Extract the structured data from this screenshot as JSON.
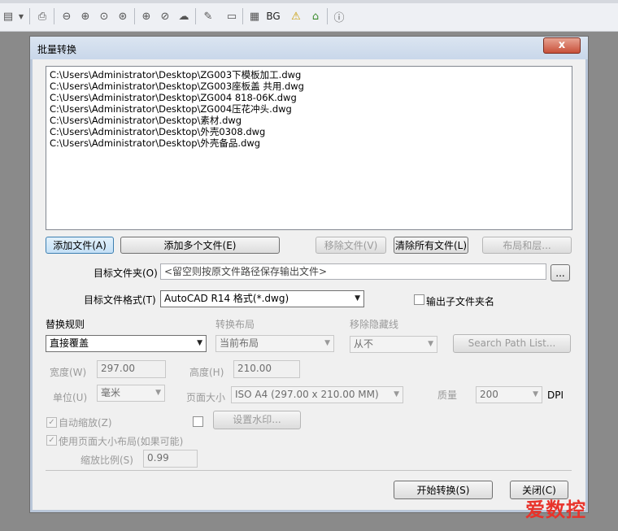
{
  "toolbar": {
    "bg_label": "BG",
    "icons": [
      "open-icon",
      "dropdown-icon",
      "print-icon",
      "zoom-out-icon",
      "zoom-in-icon",
      "zoom-window-icon",
      "zoom-dynamic-icon",
      "zoom-extents-icon",
      "zoom-realtime-icon",
      "pan-icon",
      "layer-icon",
      "layout-icon",
      "bw-icon",
      "home-icon",
      "info-icon"
    ]
  },
  "dialog": {
    "title": "批量转换",
    "close_glyph": "x",
    "files": [
      "C:\\Users\\Administrator\\Desktop\\ZG003下模板加工.dwg",
      "C:\\Users\\Administrator\\Desktop\\ZG003座板盖 共用.dwg",
      "C:\\Users\\Administrator\\Desktop\\ZG004 818-06K.dwg",
      "C:\\Users\\Administrator\\Desktop\\ZG004压花冲头.dwg",
      "C:\\Users\\Administrator\\Desktop\\素材.dwg",
      "C:\\Users\\Administrator\\Desktop\\外壳0308.dwg",
      "C:\\Users\\Administrator\\Desktop\\外壳备品.dwg"
    ],
    "buttons": {
      "add_file": "添加文件(A)",
      "add_multiple": "添加多个文件(E)",
      "remove_file": "移除文件(V)",
      "clear_all": "清除所有文件(L)",
      "layout_layers": "布局和层...",
      "browse": "...",
      "set_watermark": "设置水印...",
      "search_path": "Search Path List...",
      "start": "开始转换(S)",
      "close": "关闭(C)"
    },
    "target_folder": {
      "label": "目标文件夹(O)",
      "placeholder": "<留空则按原文件路径保存输出文件>"
    },
    "target_format": {
      "label": "目标文件格式(T)",
      "value": "AutoCAD R14 格式(*.dwg)"
    },
    "output_subfolder": {
      "label": "输出子文件夹名",
      "checked": false
    },
    "replace_rule": {
      "label": "替换规则",
      "value": "直接覆盖"
    },
    "convert_layout": {
      "label": "转换布局",
      "value": "当前布局"
    },
    "remove_hidden": {
      "label": "移除隐藏线",
      "value": "从不"
    },
    "width": {
      "label": "宽度(W)",
      "value": "297.00"
    },
    "height": {
      "label": "高度(H)",
      "value": "210.00"
    },
    "unit": {
      "label": "单位(U)",
      "value": "毫米"
    },
    "page_size": {
      "label": "页面大小",
      "value": "ISO A4 (297.00 x 210.00 MM)"
    },
    "quality": {
      "label": "质量",
      "value": "200",
      "unit": "DPI"
    },
    "auto_zoom": {
      "label": "自动缩放(Z)",
      "checked": true
    },
    "watermark_check": {
      "checked": false
    },
    "use_page_layout": {
      "label": "使用页面大小布局(如果可能)",
      "checked": true
    },
    "zoom_ratio": {
      "label": "缩放比例(S)",
      "value": "0.99"
    }
  },
  "watermark_text": "爱数控"
}
